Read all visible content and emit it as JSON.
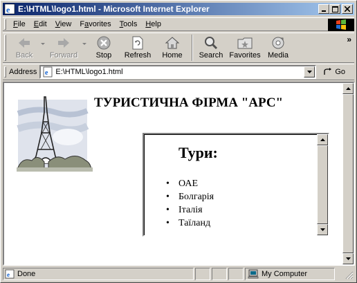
{
  "window": {
    "title": "E:\\HTML\\logo1.html - Microsoft Internet Explorer",
    "app_icon": "ie-icon",
    "controls": [
      "minimize-icon",
      "maximize-icon",
      "close-icon"
    ]
  },
  "menu": {
    "items": [
      {
        "label": "File",
        "accel": "F",
        "rest": "ile"
      },
      {
        "label": "Edit",
        "accel": "E",
        "rest": "dit"
      },
      {
        "label": "View",
        "accel": "V",
        "rest": "iew"
      },
      {
        "label": "Favorites",
        "accel": "a",
        "pre": "F",
        "rest": "vorites"
      },
      {
        "label": "Tools",
        "accel": "T",
        "rest": "ools"
      },
      {
        "label": "Help",
        "accel": "H",
        "rest": "elp"
      }
    ]
  },
  "toolbar": {
    "back": "Back",
    "forward": "Forward",
    "stop": "Stop",
    "refresh": "Refresh",
    "home": "Home",
    "search": "Search",
    "favorites": "Favorites",
    "media": "Media",
    "more": "»"
  },
  "address": {
    "label": "Address",
    "value": "E:\\HTML\\logo1.html",
    "go": "Go"
  },
  "page": {
    "heading": "ТУРИСТИЧНА ФІРМА \"АРС\"",
    "tours_title": "Тури:",
    "tours": [
      "ОАЕ",
      "Болгарія",
      "Італія",
      "Таїланд"
    ]
  },
  "status": {
    "text": "Done",
    "zone": "My Computer"
  },
  "colors": {
    "titlebar_start": "#0a246a",
    "titlebar_end": "#a6caf0",
    "chrome": "#d4d0c8"
  }
}
